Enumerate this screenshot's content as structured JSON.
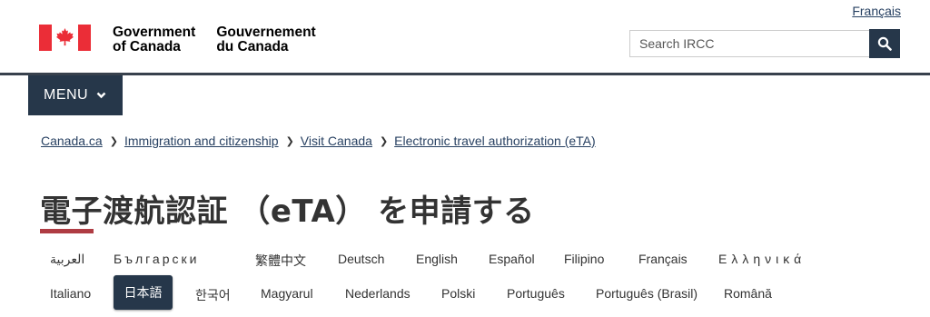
{
  "header": {
    "language_toggle": "Français",
    "signature_en": [
      "Government",
      "of Canada"
    ],
    "signature_fr": [
      "Gouvernement",
      "du Canada"
    ],
    "search_placeholder": "Search IRCC",
    "search_icon": "magnifier-icon",
    "menu_label": "MENU",
    "flag_color": "#eb2d37",
    "accent_color": "#26374a"
  },
  "breadcrumb": [
    "Canada.ca",
    "Immigration and citizenship",
    "Visit Canada",
    "Electronic travel authorization (eTA)"
  ],
  "page_title": "電子渡航認証 （eTA） を申請する",
  "languages": {
    "row1": [
      "العربية",
      "Български",
      "繁體中文",
      "Deutsch",
      "English",
      "Español",
      "Filipino",
      "Français",
      "Ελληνικά"
    ],
    "row2": [
      "Italiano",
      "日本語",
      "한국어",
      "Magyarul",
      "Nederlands",
      "Polski",
      "Português",
      "Português (Brasil)",
      "Română"
    ],
    "selected": "日本語"
  }
}
